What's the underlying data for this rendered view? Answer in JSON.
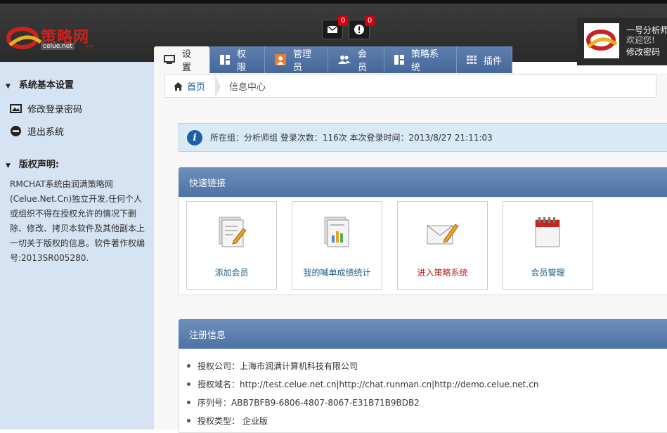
{
  "header": {
    "logo_text": "策略网",
    "logo_domain": "celue.net",
    "logo_cn": ".cn",
    "mail_count": "0",
    "alert_count": "0",
    "user": {
      "name": "一号分析师",
      "welcome": "欢迎您!",
      "change_password_link": "修改密码"
    }
  },
  "tabs": [
    {
      "label": "设置",
      "icon": "monitor-icon",
      "active": true
    },
    {
      "label": "权限",
      "icon": "layout-icon"
    },
    {
      "label": "管理员",
      "icon": "admin-icon"
    },
    {
      "label": "会员",
      "icon": "users-icon"
    },
    {
      "label": "策略系统",
      "icon": "layout-icon"
    },
    {
      "label": "插件",
      "icon": "grid-icon"
    }
  ],
  "sidebar": {
    "section1_title": "系统基本设置",
    "items": [
      {
        "label": "修改登录密码",
        "icon": "image-icon"
      },
      {
        "label": "退出系统",
        "icon": "minus-circle-icon"
      }
    ],
    "section2_title": "版权声明:",
    "copyright_text": "RMCHAT系统由润满策略网(Celue.Net.Cn)独立开发.任何个人或组织不得在授权允许的情况下删除、修改、拷贝本软件及其他副本上一切关于版权的信息。软件著作权编号:2013SR005280."
  },
  "breadcrumb": {
    "home": "首页",
    "current": "信息中心"
  },
  "info_bar": {
    "text": "所在组：分析师组 登录次数：116次 本次登录时间：2013/8/27 21:11:03"
  },
  "quick_links": {
    "title": "快速链接",
    "items": [
      {
        "label": "添加会员",
        "icon": "document-edit-icon"
      },
      {
        "label": "我的喊单成绩统计",
        "icon": "chart-document-icon"
      },
      {
        "label": "进入策略系统",
        "icon": "envelope-edit-icon"
      },
      {
        "label": "会员管理",
        "icon": "calendar-icon"
      }
    ]
  },
  "registration": {
    "title": "注册信息",
    "items": [
      "授权公司：上海市润满计算机科技有限公司",
      "授权域名：http://test.celue.net.cn|http://chat.runman.cn|http://demo.celue.net.cn",
      "序列号：ABB7BFB9-6806-4807-8067-E31B71B9BDB2",
      "授权类型：  企业版"
    ]
  },
  "colors": {
    "accent": "#4e72a6",
    "sidebar_bg": "#d5e3f3",
    "badge": "#d4000a"
  }
}
